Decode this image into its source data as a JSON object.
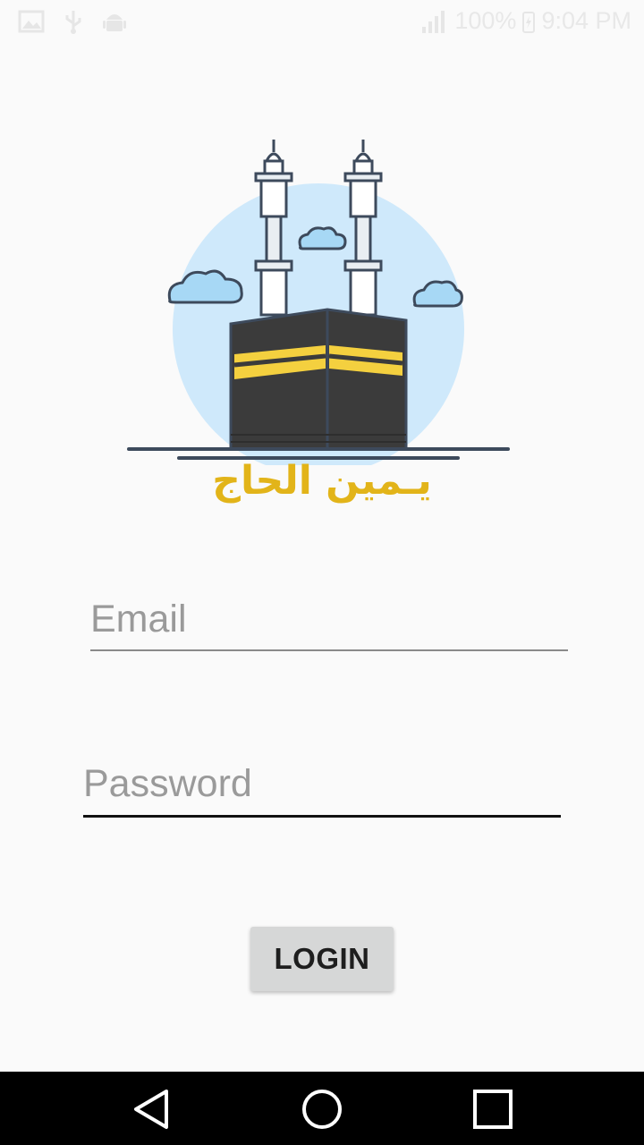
{
  "status_bar": {
    "battery": "100%",
    "time": "9:04 PM",
    "icons": [
      "image-icon",
      "usb-icon",
      "android-debug-icon",
      "signal-icon",
      "battery-charging-icon"
    ]
  },
  "logo": {
    "text": "يـمين الحاج",
    "colors": {
      "sky_circle": "#cfe9fb",
      "kaaba": "#3b3b3b",
      "kaaba_band": "#f4d03f",
      "outline": "#3d4a5c",
      "cloud": "#a7d8f5",
      "text": "#e2b419"
    }
  },
  "form": {
    "email": {
      "placeholder": "Email",
      "value": ""
    },
    "password": {
      "placeholder": "Password",
      "value": ""
    },
    "login_label": "LOGIN"
  },
  "nav_bar": {
    "icons": [
      "back-icon",
      "home-icon",
      "recents-icon"
    ]
  }
}
